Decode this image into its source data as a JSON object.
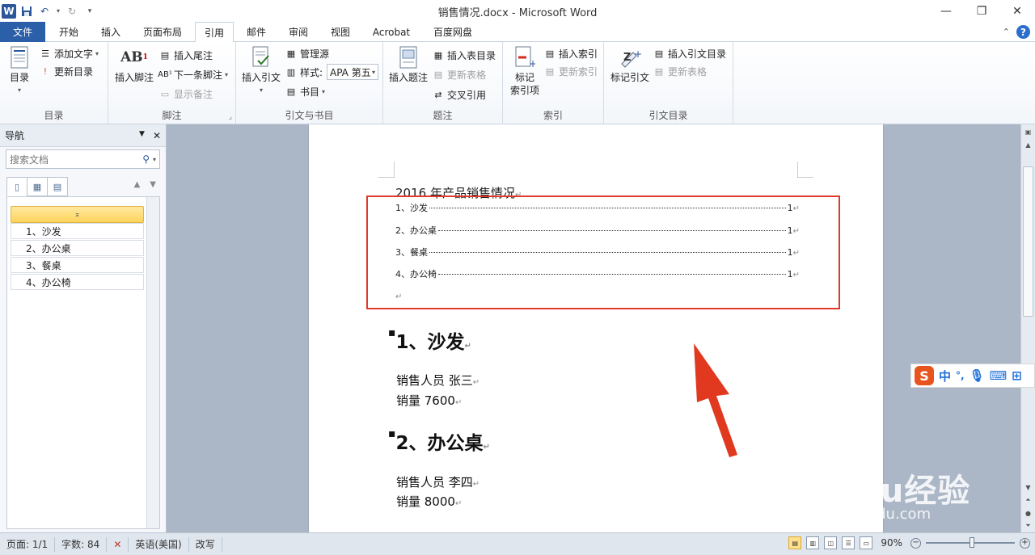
{
  "window": {
    "title": "销售情况.docx - Microsoft Word"
  },
  "tabs": [
    {
      "label": "文件"
    },
    {
      "label": "开始"
    },
    {
      "label": "插入"
    },
    {
      "label": "页面布局"
    },
    {
      "label": "引用"
    },
    {
      "label": "邮件"
    },
    {
      "label": "审阅"
    },
    {
      "label": "视图"
    },
    {
      "label": "Acrobat"
    },
    {
      "label": "百度网盘"
    }
  ],
  "ribbon": {
    "toc": {
      "group_label": "目录",
      "toc_button": "目录",
      "add_text": "添加文字",
      "update_toc": "更新目录"
    },
    "footnotes": {
      "group_label": "脚注",
      "insert_footnote": "插入脚注",
      "insert_endnote": "插入尾注",
      "next_footnote": "下一条脚注",
      "show_notes": "显示备注"
    },
    "citations": {
      "group_label": "引文与书目",
      "insert_citation": "插入引文",
      "manage_sources": "管理源",
      "style_label": "样式:",
      "style_value": "APA 第五",
      "bibliography": "书目"
    },
    "captions": {
      "group_label": "题注",
      "insert_caption": "插入题注",
      "insert_table_of_figures": "插入表目录",
      "update_table": "更新表格",
      "cross_reference": "交叉引用"
    },
    "index": {
      "group_label": "索引",
      "mark_entry": "标记\n索引项",
      "insert_index": "插入索引",
      "update_index": "更新索引"
    },
    "toa": {
      "group_label": "引文目录",
      "mark_citation": "标记引文",
      "insert_toa": "插入引文目录",
      "update_table": "更新表格"
    }
  },
  "nav": {
    "title": "导航",
    "search_placeholder": "搜索文档",
    "collapse_glyph": "⌅",
    "items": [
      {
        "label": "1、沙发"
      },
      {
        "label": "2、办公桌"
      },
      {
        "label": "3、餐桌"
      },
      {
        "label": "4、办公椅"
      }
    ]
  },
  "document": {
    "title": "2016 年产品销售情况",
    "toc": [
      {
        "label": "1、沙发",
        "page": "1"
      },
      {
        "label": "2、办公桌",
        "page": "1"
      },
      {
        "label": "3、餐桌",
        "page": "1"
      },
      {
        "label": "4、办公椅",
        "page": "1"
      }
    ],
    "sections": [
      {
        "heading": "1、沙发",
        "salesperson": "销售人员 张三",
        "volume": "销量 7600"
      },
      {
        "heading": "2、办公桌",
        "salesperson": "销售人员 李四",
        "volume": "销量 8000"
      }
    ]
  },
  "ime": {
    "logo": "S",
    "mode": "中",
    "punct": "°,"
  },
  "watermark": {
    "brand": "Baidu经验",
    "url": "jingyan.baidu.com"
  },
  "status": {
    "page": "页面: 1/1",
    "words": "字数: 84",
    "language": "英语(美国)",
    "mode": "改写",
    "zoom": "90%"
  },
  "colors": {
    "accent": "#2b5fa8",
    "highlight_box": "#e0392a",
    "arrow": "#e0391f"
  }
}
